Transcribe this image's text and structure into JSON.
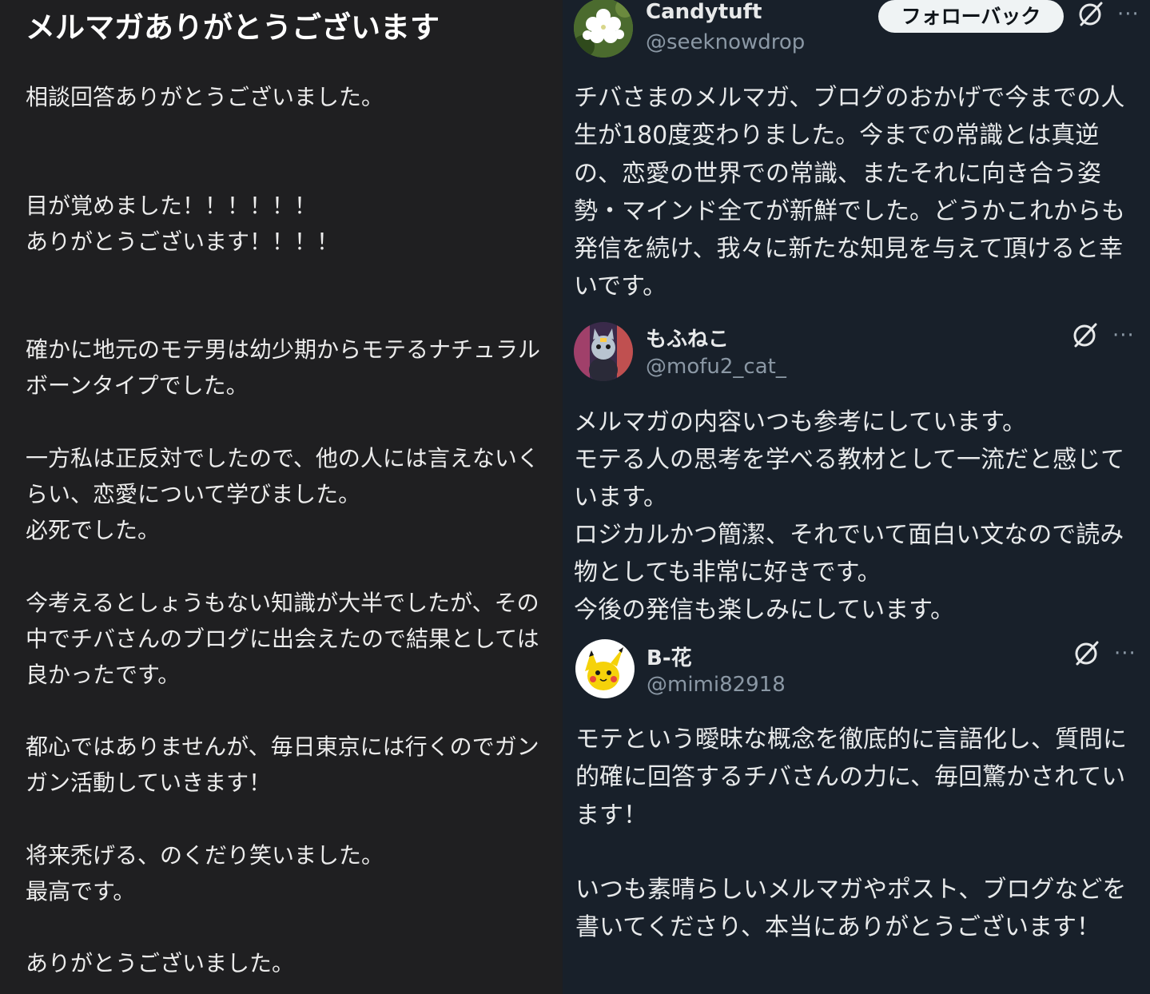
{
  "left": {
    "title": "メルマガありがとうございます",
    "paragraphs": [
      "相談回答ありがとうございました。",
      "目が覚めました！！！！！！",
      "ありがとうございます！！！！",
      "確かに地元のモテ男は幼少期からモテるナチュラルボーンタイプでした。",
      "一方私は正反対でしたので、他の人には言えないくらい、恋愛について学びました。",
      "必死でした。",
      "今考えるとしょうもない知識が大半でしたが、その中でチバさんのブログに出会えたので結果としては良かったです。",
      "都心ではありませんが、毎日東京には行くのでガンガン活動していきます！",
      "将来禿げる、のくだり笑いました。",
      "最高です。",
      "ありがとうございました。"
    ]
  },
  "posts": [
    {
      "name": "Candytuft",
      "handle": "@seeknowdrop",
      "follow_label": "フォローバック",
      "text": "チバさまのメルマガ、ブログのおかげで今までの人生が180度変わりました。今までの常識とは真逆の、恋愛の世界での常識、またそれに向き合う姿勢・マインド全てが新鮮でした。どうかこれからも発信を続け、我々に新たな知見を与えて頂けると幸いです。"
    },
    {
      "name": "もふねこ",
      "handle": "@mofu2_cat_",
      "text_lines": [
        "メルマガの内容いつも参考にしています。",
        "モテる人の思考を学べる教材として一流だと感じています。",
        "ロジカルかつ簡潔、それでいて面白い文なので読み物としても非常に好きです。",
        "今後の発信も楽しみにしています。"
      ]
    },
    {
      "name": "B-花",
      "handle": "@mimi82918",
      "text_lines": [
        "モテという曖昧な概念を徹底的に言語化し、質問に的確に回答するチバさんの力に、毎回驚かされています！",
        "いつも素晴らしいメルマガやポスト、ブログなどを書いてくださり、本当にありがとうございます！"
      ]
    }
  ],
  "icons": {
    "grok": "grok-slash-circle-icon",
    "more": "more-dots-icon"
  },
  "more_glyph": "···",
  "colors": {
    "left_bg": "#1f1f21",
    "right_bg": "#18202a",
    "secondary_text": "#8b98a5"
  }
}
